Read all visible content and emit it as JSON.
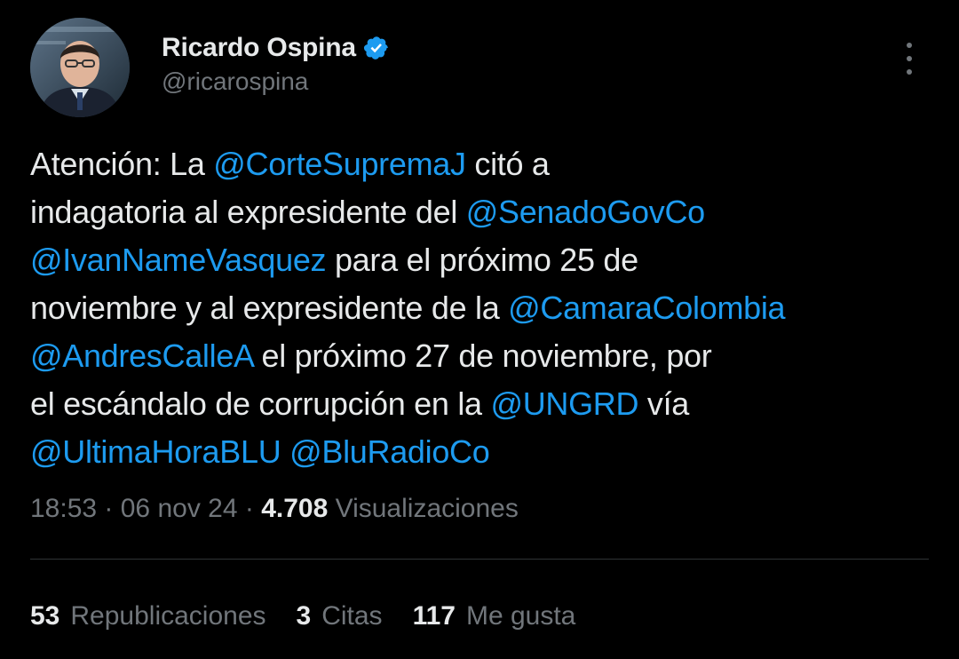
{
  "author": {
    "display_name": "Ricardo Ospina",
    "handle": "@ricarospina",
    "verified_icon": "verified-badge-icon",
    "verified_color": "#1d9bf0"
  },
  "tweet": {
    "lines": [
      [
        {
          "text": "Atención: La ",
          "type": "text"
        },
        {
          "text": "@CorteSupremaJ",
          "type": "mention"
        },
        {
          "text": " citó a",
          "type": "text"
        }
      ],
      [
        {
          "text": "indagatoria al expresidente del ",
          "type": "text"
        },
        {
          "text": "@SenadoGovCo",
          "type": "mention"
        }
      ],
      [
        {
          "text": "@IvanNameVasquez",
          "type": "mention"
        },
        {
          "text": " para el próximo 25 de",
          "type": "text"
        }
      ],
      [
        {
          "text": "noviembre y al expresidente de la ",
          "type": "text"
        },
        {
          "text": "@CamaraColombia",
          "type": "mention"
        }
      ],
      [
        {
          "text": "@AndresCalleA",
          "type": "mention"
        },
        {
          "text": " el próximo 27 de noviembre, por",
          "type": "text"
        }
      ],
      [
        {
          "text": "el escándalo de corrupción en la ",
          "type": "text"
        },
        {
          "text": "@UNGRD",
          "type": "mention"
        },
        {
          "text": " vía",
          "type": "text"
        }
      ],
      [
        {
          "text": "@UltimaHoraBLU",
          "type": "mention"
        },
        {
          "text": " ",
          "type": "text"
        },
        {
          "text": "@BluRadioCo",
          "type": "mention"
        }
      ]
    ]
  },
  "meta": {
    "time": "18:53",
    "separator": " · ",
    "date": "06 nov 24",
    "views_count": "4.708",
    "views_label": " Visualizaciones"
  },
  "stats": {
    "reposts_count": "53",
    "reposts_label": "Republicaciones",
    "quotes_count": "3",
    "quotes_label": "Citas",
    "likes_count": "117",
    "likes_label": "Me gusta"
  },
  "colors": {
    "background": "#000000",
    "text_primary": "#e7e9ea",
    "text_secondary": "#71767b",
    "link": "#1d9bf0",
    "divider": "#2f3336"
  }
}
